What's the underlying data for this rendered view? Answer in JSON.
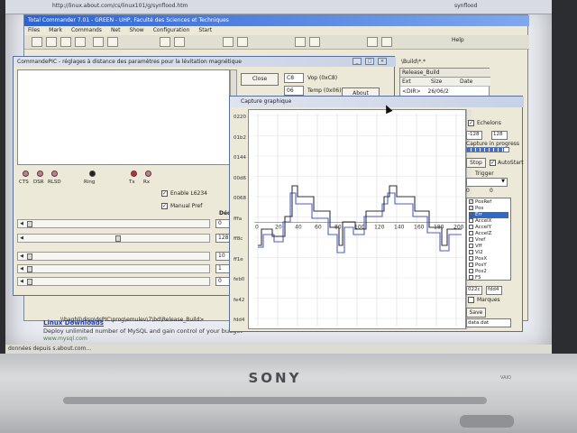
{
  "browser": {
    "url": "http://linux.about.com/cs/linux101/g/synflood.htm",
    "tab": "synflood"
  },
  "total_commander": {
    "title": "Total Commander 7.01 - GREEN - UHP, Faculté des Sciences et Techniques",
    "menu": [
      "Files",
      "Mark",
      "Commands",
      "Net",
      "Show",
      "Configuration",
      "Start"
    ],
    "right_menu": "Help",
    "right_panel": {
      "header": "Release_Build",
      "drive": "\\Build\\*.*",
      "columns": [
        "Ext",
        "Size",
        "Date"
      ],
      "first_row": {
        "size": "<DIR>",
        "date": "26/06/2"
      }
    },
    "path": "\\\\baghli\\disp\\dsPIC\\prog\\emulev\\7\\bd\\Release_Build>"
  },
  "ad": {
    "title": "Linux Downloads",
    "line": "Deploy unlimited number of MySQL and gain control of your budget",
    "url": "www.mysql.com"
  },
  "status": "données depuis s.about.com...",
  "command_window": {
    "title": "CommandePIC - réglages à distance des paramètres pour la lévitation magnétique",
    "buttons": {
      "close": "Close",
      "about": "About"
    },
    "params": [
      {
        "value": "C8",
        "label": "Vop (0xC8)"
      },
      {
        "value": "06",
        "label": "Temp (0x06)"
      }
    ],
    "leds": [
      "CTS",
      "DSR",
      "RLSD",
      "Ring",
      "Tx",
      "Rx"
    ],
    "checkboxes": [
      {
        "label": "Enable L6234",
        "checked": true
      },
      {
        "label": "Manual Pref",
        "checked": true
      }
    ],
    "decimal_label": "Décim",
    "sliders": [
      {
        "value": "0",
        "level": 0.0
      },
      {
        "value": "128",
        "level": 0.5
      },
      {
        "value": "10",
        "level": 0.0
      },
      {
        "value": "1",
        "level": 0.0
      },
      {
        "value": "0",
        "level": 0.0
      }
    ]
  },
  "capture_window": {
    "title": "Capture graphique",
    "y_ticks": [
      "0220",
      "01b2",
      "0144",
      "00d6",
      "0068",
      "fffa",
      "ff8c",
      "ff1e",
      "feb0",
      "fe42",
      "fdd4"
    ],
    "x_ticks": [
      "0",
      "20",
      "40",
      "60",
      "80",
      "100",
      "120",
      "140",
      "160",
      "180",
      "200"
    ],
    "echelons_label": "Echelons",
    "echelons_checked": true,
    "range_min": "-128",
    "range_max": "128",
    "capture_status": "Capture in progress",
    "capture_progress": 0.9,
    "stop_label": "Stop",
    "autostart_label": "AutoStart",
    "autostart_checked": true,
    "trigger_label": "Trigger",
    "trigger_values": [
      "0",
      "0"
    ],
    "channels": [
      {
        "name": "PosRef",
        "checked": true,
        "selected": false
      },
      {
        "name": "Pos",
        "checked": true,
        "selected": false
      },
      {
        "name": "Err",
        "checked": false,
        "selected": true
      },
      {
        "name": "AccelX",
        "checked": false,
        "selected": false
      },
      {
        "name": "AccelY",
        "checked": false,
        "selected": false
      },
      {
        "name": "AccelZ",
        "checked": false,
        "selected": false
      },
      {
        "name": "Vref",
        "checked": false,
        "selected": false
      },
      {
        "name": "Vff",
        "checked": false,
        "selected": false
      },
      {
        "name": "Vi2",
        "checked": false,
        "selected": false
      },
      {
        "name": "PosX",
        "checked": false,
        "selected": false
      },
      {
        "name": "PosY",
        "checked": false,
        "selected": false
      },
      {
        "name": "Pos2",
        "checked": false,
        "selected": false
      },
      {
        "name": "F5",
        "checked": false,
        "selected": false
      }
    ],
    "cursor_a": "022c",
    "cursor_b": "fdd4",
    "marques_label": "Marques",
    "save_label": "Save",
    "file": "data.dat"
  },
  "laptop": {
    "brand": "SONY",
    "label": "VAIO"
  },
  "colors": {
    "series_ref": "#333333",
    "series_pos": "#4a5fd0",
    "title_active": "#2d63d6"
  }
}
